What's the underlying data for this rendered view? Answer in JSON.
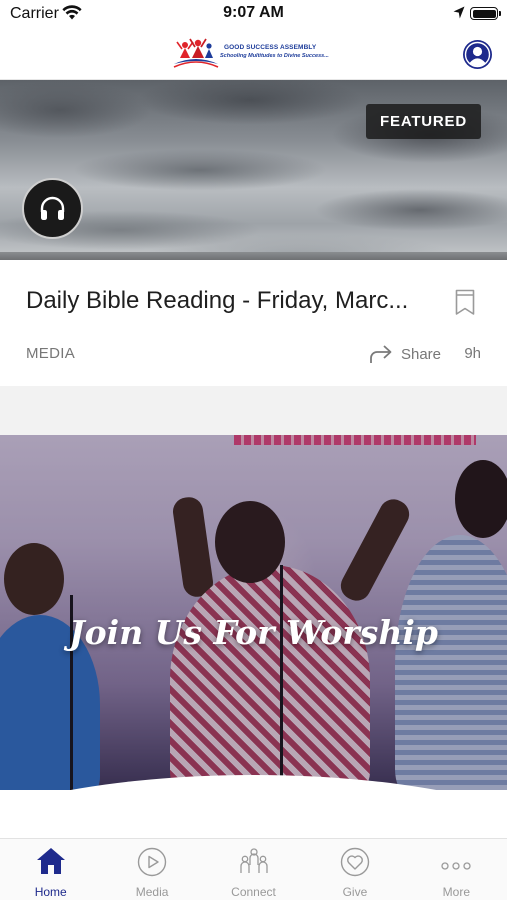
{
  "status_bar": {
    "carrier": "Carrier",
    "time": "9:07 AM",
    "wifi_icon": "wifi-icon",
    "location_icon": "location-arrow-icon",
    "battery_icon": "battery-full-icon"
  },
  "header": {
    "logo": {
      "name": "GOOD SUCCESS ASSEMBLY",
      "tagline": "Schooling Multitudes to Divine Success..."
    },
    "profile_icon": "user-profile-icon"
  },
  "featured_card": {
    "badge": "FEATURED",
    "media_icon": "headphones-icon",
    "title": "Daily Bible Reading - Friday, Marc...",
    "category": "MEDIA",
    "share_label": "Share",
    "age": "9h",
    "bookmark_icon": "bookmark-icon"
  },
  "worship_card": {
    "title": "Join Us For Worship"
  },
  "tab_bar": {
    "tabs": [
      {
        "label": "Home",
        "icon": "home-icon",
        "active": true
      },
      {
        "label": "Media",
        "icon": "play-circle-icon",
        "active": false
      },
      {
        "label": "Connect",
        "icon": "people-group-icon",
        "active": false
      },
      {
        "label": "Give",
        "icon": "heart-circle-icon",
        "active": false
      },
      {
        "label": "More",
        "icon": "more-dots-icon",
        "active": false
      }
    ]
  },
  "colors": {
    "brand": "#1e2a8c",
    "badge_bg": "#191919",
    "muted_text": "#777777",
    "inactive_tab": "#999999"
  }
}
